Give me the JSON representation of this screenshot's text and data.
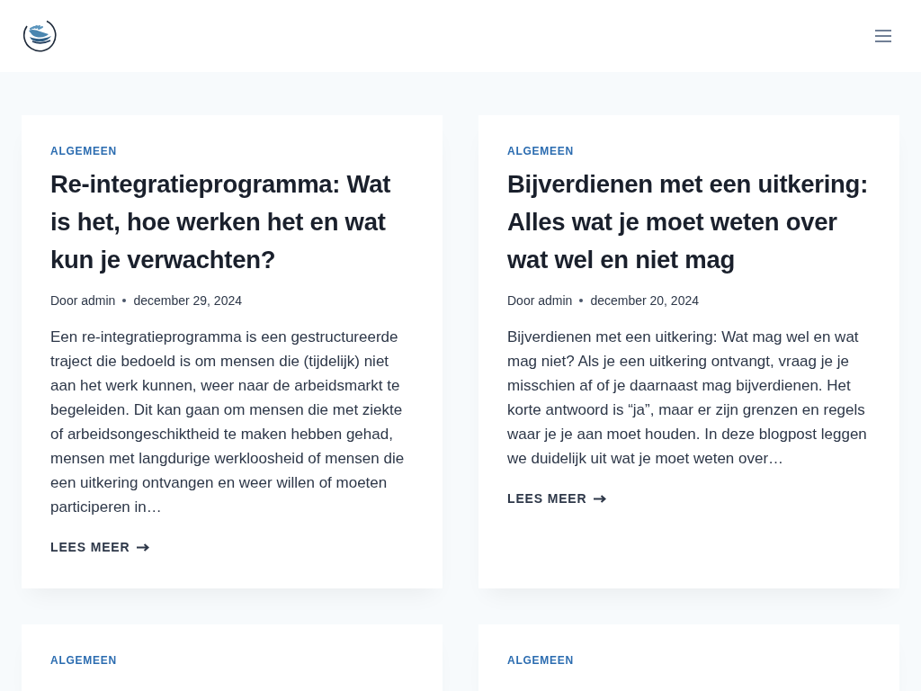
{
  "posts": [
    {
      "category": "ALGEMEEN",
      "title": "Re-integratieprogramma: Wat is het, hoe werken het en wat kun je verwachten?",
      "byline": "Door admin",
      "date": "december 29, 2024",
      "excerpt": "Een re-integratieprogramma is een gestructureerde traject die bedoeld is om mensen die (tijdelijk) niet aan het werk kunnen, weer naar de arbeidsmarkt te begeleiden. Dit kan gaan om mensen die met ziekte of arbeidsongeschiktheid te maken hebben gehad, mensen met langdurige werkloosheid of mensen die een uitkering ontvangen en weer willen of moeten participeren in…",
      "read_more": "LEES MEER"
    },
    {
      "category": "ALGEMEEN",
      "title": "Bijverdienen met een uitkering: Alles wat je moet weten over wat wel en niet mag",
      "byline": "Door admin",
      "date": "december 20, 2024",
      "excerpt": "Bijverdienen met een uitkering: Wat mag wel en wat mag niet? Als je een uitkering ontvangt, vraag je je misschien af of je daarnaast mag bijverdienen. Het korte antwoord is “ja”, maar er zijn grenzen en regels waar je je aan moet houden. In deze blogpost leggen we duidelijk uit wat je moet weten over…",
      "read_more": "LEES MEER"
    },
    {
      "category": "ALGEMEEN"
    },
    {
      "category": "ALGEMEEN"
    }
  ]
}
